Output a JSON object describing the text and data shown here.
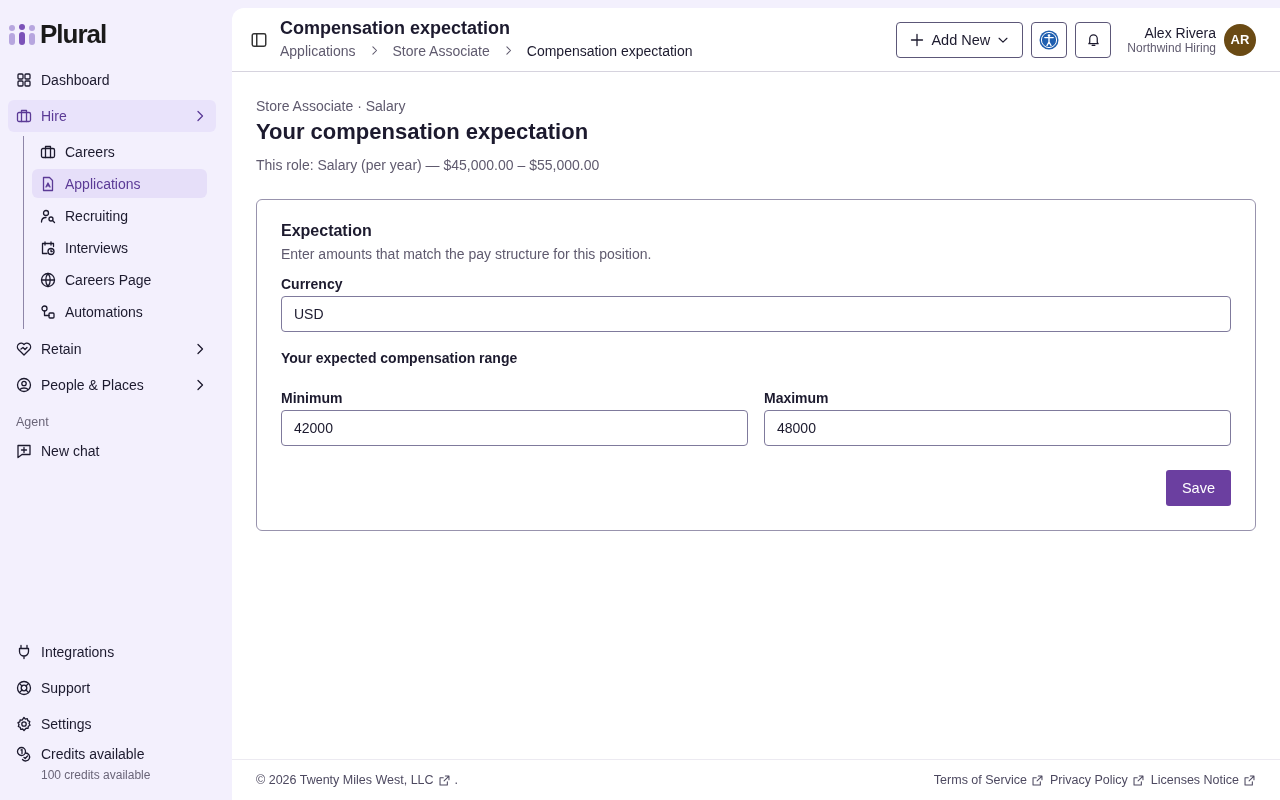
{
  "brand": {
    "name": "Plural"
  },
  "sidebar": {
    "nav": [
      {
        "label": "Dashboard",
        "selected": false,
        "expandable": false
      },
      {
        "label": "Hire",
        "selected": true,
        "expandable": true,
        "children": [
          {
            "label": "Careers",
            "selected": false
          },
          {
            "label": "Applications",
            "selected": true
          },
          {
            "label": "Recruiting",
            "selected": false
          },
          {
            "label": "Interviews",
            "selected": false
          },
          {
            "label": "Careers Page",
            "selected": false
          },
          {
            "label": "Automations",
            "selected": false
          }
        ]
      },
      {
        "label": "Retain",
        "selected": false,
        "expandable": true
      },
      {
        "label": "People & Places",
        "selected": false,
        "expandable": true
      }
    ],
    "agent": {
      "heading": "Agent",
      "items": [
        {
          "label": "New chat"
        }
      ]
    },
    "bottom": [
      {
        "label": "Integrations"
      },
      {
        "label": "Support"
      },
      {
        "label": "Settings"
      }
    ],
    "credits": {
      "label": "Credits available",
      "detail": "100 credits available"
    }
  },
  "header": {
    "title": "Compensation expectation",
    "breadcrumbs": [
      "Applications",
      "Store Associate",
      "Compensation expectation"
    ],
    "add_button": "Add New",
    "user": {
      "name": "Alex Rivera",
      "org": "Northwind Hiring",
      "initials": "AR"
    }
  },
  "page": {
    "eyebrow": "Store Associate · Salary",
    "heading": "Your compensation expectation",
    "subtitle": "This role: Salary (per year) — $45,000.00 – $55,000.00"
  },
  "card": {
    "title": "Expectation",
    "description": "Enter amounts that match the pay structure for this position.",
    "currency": {
      "label": "Currency",
      "value": "USD"
    },
    "range_heading": "Your expected compensation range",
    "minimum": {
      "label": "Minimum",
      "value": "42000"
    },
    "maximum": {
      "label": "Maximum",
      "value": "48000"
    },
    "save_button": "Save"
  },
  "footer": {
    "copyright": "© 2026 Twenty Miles West, LLC",
    "copyright_suffix": ".",
    "links": [
      "Terms of Service",
      "Privacy Policy",
      "Licenses Notice"
    ]
  }
}
